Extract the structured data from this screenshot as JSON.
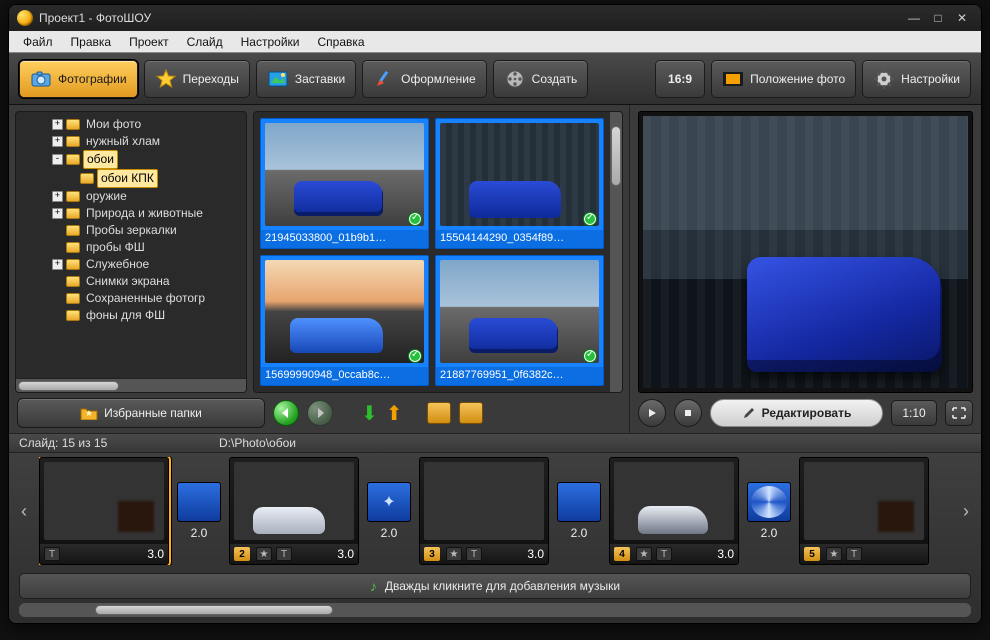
{
  "window": {
    "title": "Проект1 - ФотоШОУ"
  },
  "menu": {
    "file": "Файл",
    "edit": "Правка",
    "project": "Проект",
    "slide": "Слайд",
    "settings": "Настройки",
    "help": "Справка"
  },
  "toolbar": {
    "photos": "Фотографии",
    "transitions": "Переходы",
    "bumpers": "Заставки",
    "design": "Оформление",
    "create": "Создать",
    "aspect": "16:9",
    "posphoto": "Положение фото",
    "settings": "Настройки"
  },
  "tree": {
    "items": [
      {
        "label": "Мои фото",
        "exp": "+"
      },
      {
        "label": "нужный хлам",
        "exp": "+"
      },
      {
        "label": "обои",
        "exp": "-",
        "selected": true,
        "children": [
          {
            "label": "обои КПК"
          }
        ]
      },
      {
        "label": "оружие",
        "exp": "+"
      },
      {
        "label": "Природа и животные",
        "exp": "+"
      },
      {
        "label": "Пробы зеркалки"
      },
      {
        "label": "пробы ФШ"
      },
      {
        "label": "Служебное",
        "exp": "+"
      },
      {
        "label": "Снимки экрана"
      },
      {
        "label": "Сохраненные фотогр"
      },
      {
        "label": "фоны для ФШ"
      }
    ]
  },
  "thumbs": [
    {
      "name": "21945033800_01b9b1…",
      "style": "car-road"
    },
    {
      "name": "15504144290_0354f89…",
      "style": "car-garage"
    },
    {
      "name": "15699990948_0ccab8c…",
      "style": "car-sunset"
    },
    {
      "name": "21887769951_0f6382c…",
      "style": "car-road"
    }
  ],
  "favbtn": "Избранные папки",
  "preview": {
    "edit": "Редактировать",
    "time": "1:10"
  },
  "info": {
    "slide_counter": "Слайд: 15 из 15",
    "path": "D:\\Photo\\обои"
  },
  "timeline": {
    "slides": [
      {
        "num": "",
        "dur": "3.0",
        "img": "s-img1",
        "T": true
      },
      {
        "num": "2",
        "dur": "3.0",
        "img": "s-img2"
      },
      {
        "num": "3",
        "dur": "3.0",
        "img": "s-img3"
      },
      {
        "num": "4",
        "dur": "3.0",
        "img": "s-img4"
      },
      {
        "num": "5",
        "dur": "",
        "img": "s-img1"
      }
    ],
    "transitions": [
      {
        "dur": "2.0",
        "style": ""
      },
      {
        "dur": "2.0",
        "style": "t-cross"
      },
      {
        "dur": "2.0",
        "style": ""
      },
      {
        "dur": "2.0",
        "style": "t-swirl"
      }
    ]
  },
  "music_hint": "Дважды кликните для добавления музыки"
}
